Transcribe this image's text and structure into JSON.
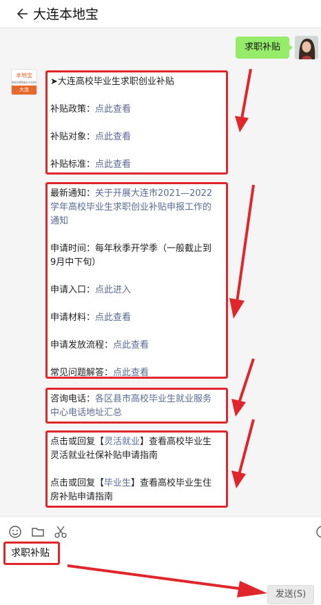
{
  "header": {
    "title": "大连本地宝",
    "back_icon": "back-arrow-icon"
  },
  "conversation": {
    "user_message": "求职补贴",
    "bot_avatar": {
      "brand": "本地宝",
      "sub": "bendibao.com",
      "city": "大连"
    },
    "messages": [
      {
        "title": "➤大连高校毕业生求职创业补贴",
        "rows": [
          {
            "label": "补贴政策：",
            "link": "点此查看"
          },
          {
            "label": "补贴对象：",
            "link": "点此查看"
          },
          {
            "label": "补贴标准：",
            "link": "点此查看"
          }
        ]
      },
      {
        "notice_label": "最新通知：",
        "notice_link_lines": [
          "关于开展大连市2021—2022",
          "学年高校毕业生求职创业补贴申报工作的",
          "通知"
        ],
        "time_lines": [
          "申请时间：每年秋季开学季（一般截止到",
          "9月中下旬）"
        ],
        "rows": [
          {
            "label": "申请入口：",
            "link": "点此进入"
          },
          {
            "label": "申请材料：",
            "link": "点此查看"
          },
          {
            "label": "申请发放流程：",
            "link": "点此查看"
          },
          {
            "label": "常见问题解答：",
            "link": "点此查看"
          }
        ]
      },
      {
        "label": "咨询电话：",
        "link_lines": [
          "各区县市高校毕业生就业服务",
          "中心电话地址汇总"
        ]
      },
      {
        "p1": {
          "pre": "点击或回复【",
          "key": "灵活就业",
          "post": "】查看高校毕业生",
          "line2": "灵活就业社保补贴申请指南"
        },
        "p2": {
          "pre": "点击或回复【",
          "key": "毕业生",
          "post": "】查看高校毕业生住",
          "line2": "房补贴申请指南"
        }
      }
    ]
  },
  "composer": {
    "tools": [
      "emoji-icon",
      "folder-icon",
      "scissors-icon"
    ],
    "input_value": "求职补贴",
    "send_label": "发送(S)"
  },
  "colors": {
    "accent_red": "#e0262a",
    "link": "#576b95",
    "user_bubble": "#95ec69"
  }
}
